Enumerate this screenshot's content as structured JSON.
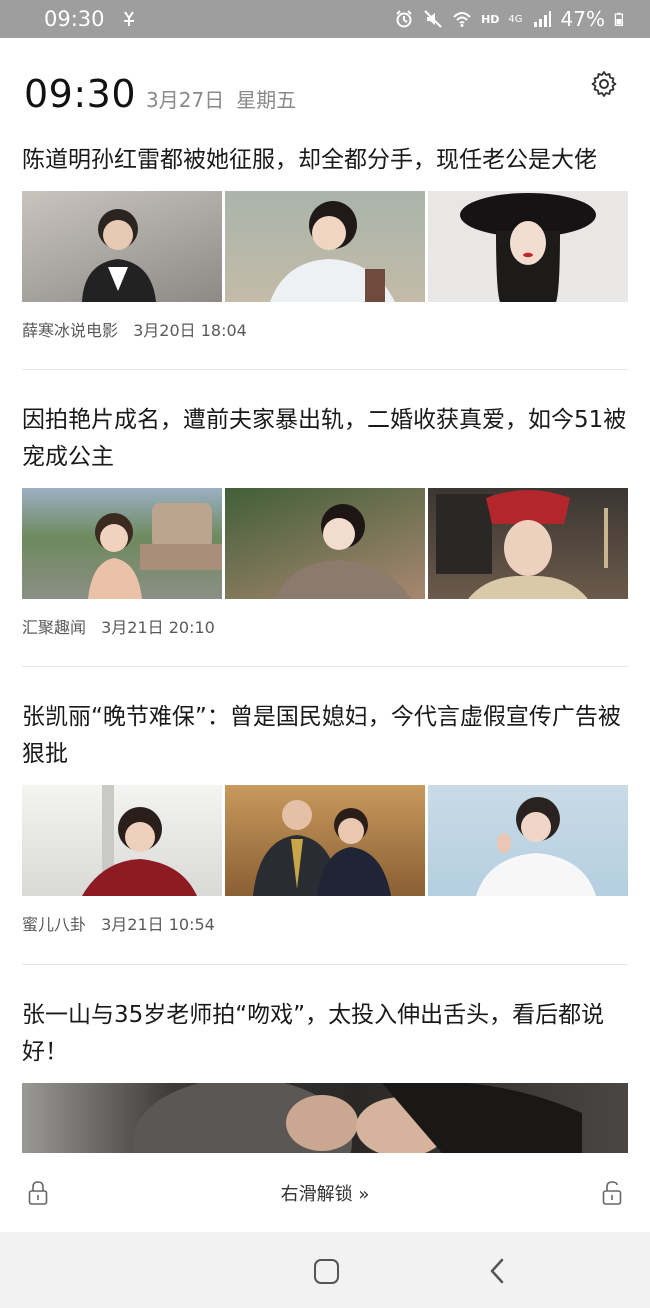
{
  "statusbar": {
    "time": "09:30",
    "battery": "47%",
    "net": "HD",
    "signal": "4G"
  },
  "header": {
    "time": "09:30",
    "date": "3月27日",
    "weekday": "星期五"
  },
  "articles": [
    {
      "title": "陈道明孙红雷都被她征服，却全都分手，现任老公是大佬",
      "source": "薛寒冰说电影",
      "datetime": "3月20日 18:04"
    },
    {
      "title": "因拍艳片成名，遭前夫家暴出轨，二婚收获真爱，如今51被宠成公主",
      "source": "汇聚趣闻",
      "datetime": "3月21日 20:10"
    },
    {
      "title": "张凯丽“晚节难保”：曾是国民媳妇，今代言虚假宣传广告被狠批",
      "source": "蜜儿八卦",
      "datetime": "3月21日 10:54"
    },
    {
      "title": "张一山与35岁老师拍“吻戏”，太投入伸出舌头，看后都说好！"
    }
  ],
  "unlock": {
    "label": "右滑解锁 »"
  }
}
